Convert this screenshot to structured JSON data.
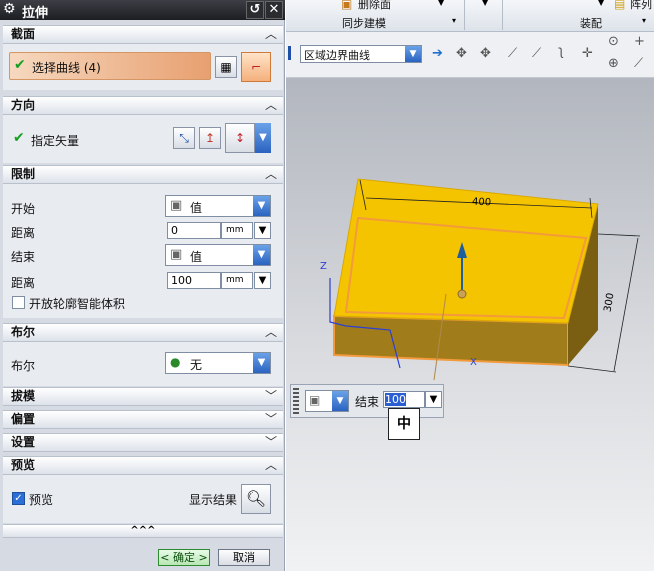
{
  "dialog": {
    "title": "拉伸",
    "sections": {
      "section": "截面",
      "direction": "方向",
      "limits": "限制",
      "boolean": "布尔",
      "draft": "拔模",
      "offset": "偏置",
      "settings": "设置",
      "preview": "预览"
    },
    "select_curve": "选择曲线 (4)",
    "specify_vector": "指定矢量",
    "start_label": "开始",
    "start_value": "值",
    "distance_label_1": "距离",
    "distance_value_1": "0",
    "unit_1": "mm",
    "end_label": "结束",
    "end_value": "值",
    "distance_label_2": "距离",
    "distance_value_2": "100",
    "unit_2": "mm",
    "open_profile": "开放轮廓智能体积",
    "boolean_label": "布尔",
    "boolean_value": "无",
    "preview_label": "预览",
    "show_result": "显示结果",
    "expand_marker": "^^^",
    "ok": "< 确定 >",
    "cancel": "取消"
  },
  "ribbon": {
    "delete_face": "删除面",
    "sync_modeling": "同步建模",
    "assembly": "装配",
    "pattern": "阵列"
  },
  "toolbar": {
    "filter_value": "区域边界曲线"
  },
  "viewport": {
    "dim_top": "400",
    "dim_side": "300",
    "axis_z": "Z",
    "axis_x": "X",
    "float_end_label": "结束",
    "float_end_value": "100",
    "tooltip": "中"
  },
  "colors": {
    "block_top": "#f5c400",
    "block_side": "#a07d1a",
    "highlight": "#f29a3c",
    "selection": "#e8a070"
  }
}
